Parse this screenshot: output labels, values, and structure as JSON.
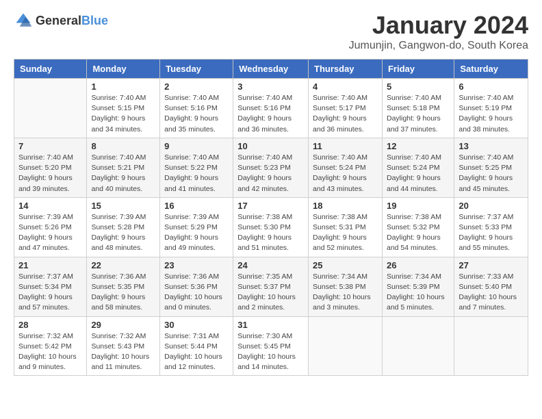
{
  "header": {
    "logo_general": "General",
    "logo_blue": "Blue",
    "month_title": "January 2024",
    "location": "Jumunjin, Gangwon-do, South Korea"
  },
  "weekdays": [
    "Sunday",
    "Monday",
    "Tuesday",
    "Wednesday",
    "Thursday",
    "Friday",
    "Saturday"
  ],
  "weeks": [
    [
      {
        "day": "",
        "sunrise": "",
        "sunset": "",
        "daylight": ""
      },
      {
        "day": "1",
        "sunrise": "Sunrise: 7:40 AM",
        "sunset": "Sunset: 5:15 PM",
        "daylight": "Daylight: 9 hours and 34 minutes."
      },
      {
        "day": "2",
        "sunrise": "Sunrise: 7:40 AM",
        "sunset": "Sunset: 5:16 PM",
        "daylight": "Daylight: 9 hours and 35 minutes."
      },
      {
        "day": "3",
        "sunrise": "Sunrise: 7:40 AM",
        "sunset": "Sunset: 5:16 PM",
        "daylight": "Daylight: 9 hours and 36 minutes."
      },
      {
        "day": "4",
        "sunrise": "Sunrise: 7:40 AM",
        "sunset": "Sunset: 5:17 PM",
        "daylight": "Daylight: 9 hours and 36 minutes."
      },
      {
        "day": "5",
        "sunrise": "Sunrise: 7:40 AM",
        "sunset": "Sunset: 5:18 PM",
        "daylight": "Daylight: 9 hours and 37 minutes."
      },
      {
        "day": "6",
        "sunrise": "Sunrise: 7:40 AM",
        "sunset": "Sunset: 5:19 PM",
        "daylight": "Daylight: 9 hours and 38 minutes."
      }
    ],
    [
      {
        "day": "7",
        "sunrise": "Sunrise: 7:40 AM",
        "sunset": "Sunset: 5:20 PM",
        "daylight": "Daylight: 9 hours and 39 minutes."
      },
      {
        "day": "8",
        "sunrise": "Sunrise: 7:40 AM",
        "sunset": "Sunset: 5:21 PM",
        "daylight": "Daylight: 9 hours and 40 minutes."
      },
      {
        "day": "9",
        "sunrise": "Sunrise: 7:40 AM",
        "sunset": "Sunset: 5:22 PM",
        "daylight": "Daylight: 9 hours and 41 minutes."
      },
      {
        "day": "10",
        "sunrise": "Sunrise: 7:40 AM",
        "sunset": "Sunset: 5:23 PM",
        "daylight": "Daylight: 9 hours and 42 minutes."
      },
      {
        "day": "11",
        "sunrise": "Sunrise: 7:40 AM",
        "sunset": "Sunset: 5:24 PM",
        "daylight": "Daylight: 9 hours and 43 minutes."
      },
      {
        "day": "12",
        "sunrise": "Sunrise: 7:40 AM",
        "sunset": "Sunset: 5:24 PM",
        "daylight": "Daylight: 9 hours and 44 minutes."
      },
      {
        "day": "13",
        "sunrise": "Sunrise: 7:40 AM",
        "sunset": "Sunset: 5:25 PM",
        "daylight": "Daylight: 9 hours and 45 minutes."
      }
    ],
    [
      {
        "day": "14",
        "sunrise": "Sunrise: 7:39 AM",
        "sunset": "Sunset: 5:26 PM",
        "daylight": "Daylight: 9 hours and 47 minutes."
      },
      {
        "day": "15",
        "sunrise": "Sunrise: 7:39 AM",
        "sunset": "Sunset: 5:28 PM",
        "daylight": "Daylight: 9 hours and 48 minutes."
      },
      {
        "day": "16",
        "sunrise": "Sunrise: 7:39 AM",
        "sunset": "Sunset: 5:29 PM",
        "daylight": "Daylight: 9 hours and 49 minutes."
      },
      {
        "day": "17",
        "sunrise": "Sunrise: 7:38 AM",
        "sunset": "Sunset: 5:30 PM",
        "daylight": "Daylight: 9 hours and 51 minutes."
      },
      {
        "day": "18",
        "sunrise": "Sunrise: 7:38 AM",
        "sunset": "Sunset: 5:31 PM",
        "daylight": "Daylight: 9 hours and 52 minutes."
      },
      {
        "day": "19",
        "sunrise": "Sunrise: 7:38 AM",
        "sunset": "Sunset: 5:32 PM",
        "daylight": "Daylight: 9 hours and 54 minutes."
      },
      {
        "day": "20",
        "sunrise": "Sunrise: 7:37 AM",
        "sunset": "Sunset: 5:33 PM",
        "daylight": "Daylight: 9 hours and 55 minutes."
      }
    ],
    [
      {
        "day": "21",
        "sunrise": "Sunrise: 7:37 AM",
        "sunset": "Sunset: 5:34 PM",
        "daylight": "Daylight: 9 hours and 57 minutes."
      },
      {
        "day": "22",
        "sunrise": "Sunrise: 7:36 AM",
        "sunset": "Sunset: 5:35 PM",
        "daylight": "Daylight: 9 hours and 58 minutes."
      },
      {
        "day": "23",
        "sunrise": "Sunrise: 7:36 AM",
        "sunset": "Sunset: 5:36 PM",
        "daylight": "Daylight: 10 hours and 0 minutes."
      },
      {
        "day": "24",
        "sunrise": "Sunrise: 7:35 AM",
        "sunset": "Sunset: 5:37 PM",
        "daylight": "Daylight: 10 hours and 2 minutes."
      },
      {
        "day": "25",
        "sunrise": "Sunrise: 7:34 AM",
        "sunset": "Sunset: 5:38 PM",
        "daylight": "Daylight: 10 hours and 3 minutes."
      },
      {
        "day": "26",
        "sunrise": "Sunrise: 7:34 AM",
        "sunset": "Sunset: 5:39 PM",
        "daylight": "Daylight: 10 hours and 5 minutes."
      },
      {
        "day": "27",
        "sunrise": "Sunrise: 7:33 AM",
        "sunset": "Sunset: 5:40 PM",
        "daylight": "Daylight: 10 hours and 7 minutes."
      }
    ],
    [
      {
        "day": "28",
        "sunrise": "Sunrise: 7:32 AM",
        "sunset": "Sunset: 5:42 PM",
        "daylight": "Daylight: 10 hours and 9 minutes."
      },
      {
        "day": "29",
        "sunrise": "Sunrise: 7:32 AM",
        "sunset": "Sunset: 5:43 PM",
        "daylight": "Daylight: 10 hours and 11 minutes."
      },
      {
        "day": "30",
        "sunrise": "Sunrise: 7:31 AM",
        "sunset": "Sunset: 5:44 PM",
        "daylight": "Daylight: 10 hours and 12 minutes."
      },
      {
        "day": "31",
        "sunrise": "Sunrise: 7:30 AM",
        "sunset": "Sunset: 5:45 PM",
        "daylight": "Daylight: 10 hours and 14 minutes."
      },
      {
        "day": "",
        "sunrise": "",
        "sunset": "",
        "daylight": ""
      },
      {
        "day": "",
        "sunrise": "",
        "sunset": "",
        "daylight": ""
      },
      {
        "day": "",
        "sunrise": "",
        "sunset": "",
        "daylight": ""
      }
    ]
  ]
}
